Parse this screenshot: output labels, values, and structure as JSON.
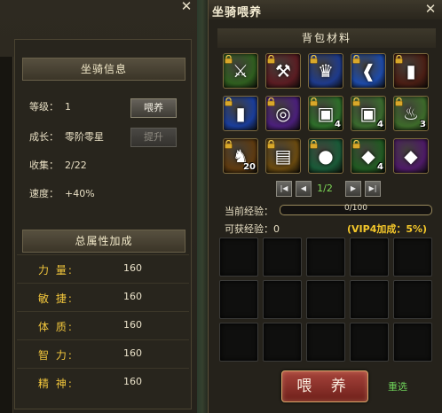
{
  "left": {
    "mount_info_title": "坐骑信息",
    "level_label": "等级：",
    "level_value": "1",
    "feed_button": "喂养",
    "growth_label": "成长：",
    "growth_value": "零阶零星",
    "upgrade_button": "提升",
    "collect_label": "收集：",
    "collect_value": "2/22",
    "speed_label": "速度：",
    "speed_value": "+40%",
    "total_attr_title": "总属性加成",
    "attributes": [
      {
        "label": "力 量:",
        "value": "160"
      },
      {
        "label": "敏 捷:",
        "value": "160"
      },
      {
        "label": "体 质:",
        "value": "160"
      },
      {
        "label": "智 力:",
        "value": "160"
      },
      {
        "label": "精 神:",
        "value": "160"
      }
    ]
  },
  "right": {
    "title": "坐骑喂养",
    "bag_title": "背包材料",
    "items": [
      {
        "icon": "green-sword-icon",
        "glyph": "⚔",
        "count": "",
        "bg": "#2f5e1f",
        "locked": true
      },
      {
        "icon": "red-hammer-icon",
        "glyph": "⚒",
        "count": "",
        "bg": "#5a1c22",
        "locked": true
      },
      {
        "icon": "gold-dragon-helm-icon",
        "glyph": "♛",
        "count": "",
        "bg": "#1e3a8a",
        "locked": true
      },
      {
        "icon": "blue-boot-icon",
        "glyph": "❰",
        "count": "",
        "bg": "#1d4aa8",
        "locked": true
      },
      {
        "icon": "red-boots-icon",
        "glyph": "▮",
        "count": "",
        "bg": "#4a1e14",
        "locked": true
      },
      {
        "icon": "blue-gold-greaves-icon",
        "glyph": "▮",
        "count": "",
        "bg": "#1a3d9a",
        "locked": true
      },
      {
        "icon": "purple-ring-icon",
        "glyph": "◎",
        "count": "",
        "bg": "#4a1f7a",
        "locked": true
      },
      {
        "icon": "green-chest-icon",
        "glyph": "▣",
        "count": "4",
        "bg": "#2e6e2a",
        "locked": true
      },
      {
        "icon": "gold-chest-icon",
        "glyph": "▣",
        "count": "4",
        "bg": "#3a6a2e",
        "locked": true
      },
      {
        "icon": "potion-icon",
        "glyph": "♨",
        "count": "3",
        "bg": "#3d6a2a",
        "locked": true
      },
      {
        "icon": "horse-icon",
        "glyph": "♞",
        "count": "20",
        "bg": "#5e3a10",
        "locked": true
      },
      {
        "icon": "skill-book-icon",
        "glyph": "▤",
        "count": "",
        "bg": "#6a4a10",
        "locked": true
      },
      {
        "icon": "green-orb-icon",
        "glyph": "●",
        "count": "",
        "bg": "#1a5a38",
        "locked": true
      },
      {
        "icon": "emerald-gem-icon",
        "glyph": "◆",
        "count": "4",
        "bg": "#215a22",
        "locked": true
      },
      {
        "icon": "purple-crystal-icon",
        "glyph": "◆",
        "count": "",
        "bg": "#4d1a66",
        "locked": false
      }
    ],
    "page": "1/2",
    "current_exp_label": "当前经验：",
    "current_exp_text": "0/100",
    "current_exp_fraction": 0,
    "gain_exp_label": "可获经验：0",
    "vip_text": "(VIP4加成：5%)",
    "feed_button": "喂 养",
    "reselect_link": "重选"
  },
  "colors": {
    "gold_text": "#f2c63c",
    "green_text": "#6fd35a",
    "vip_gold": "#f5c82a",
    "feed_red": "#8f3029"
  }
}
